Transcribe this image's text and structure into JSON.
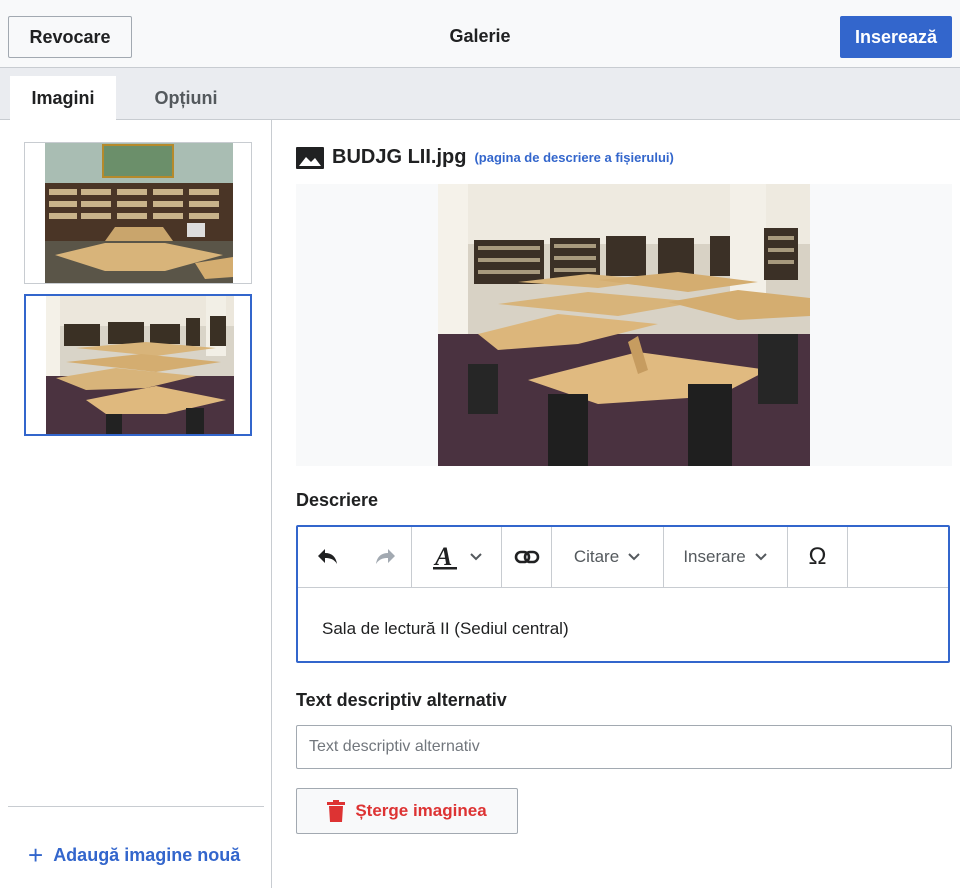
{
  "header": {
    "cancel_label": "Revocare",
    "title": "Galerie",
    "insert_label": "Inserează"
  },
  "tabs": [
    {
      "label": "Imagini",
      "active": true
    },
    {
      "label": "Opțiuni",
      "active": false
    }
  ],
  "gallery": {
    "thumbnails": [
      {
        "name": "library-room-thumbnail",
        "selected": false
      },
      {
        "name": "reading-room-thumbnail",
        "selected": true
      }
    ],
    "add_label": "Adaugă imagine nouă"
  },
  "file": {
    "name": "BUDJG LII.jpg",
    "link_label": "(pagina de descriere a fișierului)"
  },
  "description": {
    "label": "Descriere",
    "toolbar": {
      "icons": [
        "undo-icon",
        "redo-icon",
        "text-style-icon",
        "chevron-down-icon",
        "link-icon",
        "special-character-icon"
      ],
      "cite_label": "Citare",
      "insert_label": "Inserare",
      "special_char": "Ω"
    },
    "text": "Sala de lectură II (Sediul central)"
  },
  "alt_text": {
    "label": "Text descriptiv alternativ",
    "placeholder": "Text descriptiv alternativ",
    "value": ""
  },
  "delete_label": "Șterge imaginea",
  "colors": {
    "accent": "#3366cc",
    "destructive": "#dd3333",
    "border": "#c8ccd1"
  }
}
